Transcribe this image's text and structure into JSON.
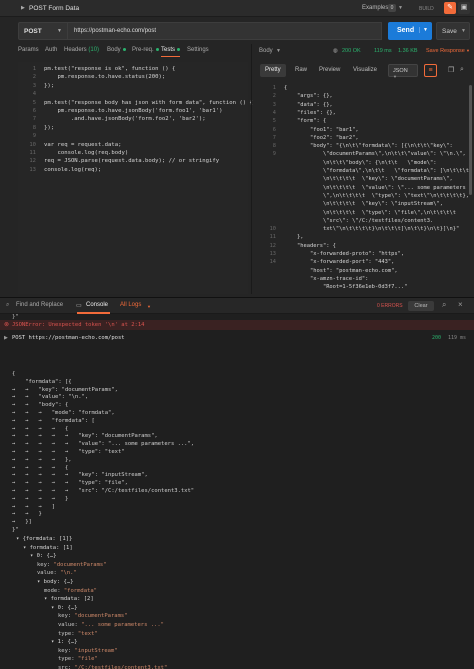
{
  "window": {
    "title": "POST Form Data",
    "examples_label": "Examples",
    "examples_count": "0",
    "build_label": "BUILD"
  },
  "request": {
    "method": "POST",
    "url": "https://postman-echo.com/post",
    "send_label": "Send",
    "save_label": "Save"
  },
  "request_tabs": [
    {
      "label": "Params"
    },
    {
      "label": "Auth"
    },
    {
      "label": "Headers",
      "count": "(10)"
    },
    {
      "label": "Body"
    },
    {
      "label": "Pre-req."
    },
    {
      "label": "Tests"
    },
    {
      "label": "Settings"
    }
  ],
  "test_script": [
    "pm.test(\"response is ok\", function () {",
    "    pm.response.to.have.status(200);",
    "});",
    "",
    "pm.test(\"response body has json with form data\", function () {",
    "    pm.response.to.have.jsonBody('form.foo1', 'bar1')",
    "        .and.have.jsonBody('form.foo2', 'bar2');",
    "});",
    "",
    "var req = request.data;",
    "    console.log(req.body)",
    "req = JSON.parse(request.data.body); // or stringify",
    "console.log(req);"
  ],
  "test_line_numbers": [
    "1",
    "2",
    "3",
    "4",
    "5",
    "6",
    "7",
    "8",
    "9",
    "10",
    "11",
    "12",
    "13"
  ],
  "response": {
    "body_label": "Body",
    "status": "200 OK",
    "time": "119 ms",
    "size": "1.36 KB",
    "save_label": "Save Response",
    "view_tabs": [
      "Pretty",
      "Raw",
      "Preview",
      "Visualize"
    ],
    "format": "JSON",
    "line_numbers": [
      "1",
      "2",
      "3",
      "4",
      "5",
      "6",
      "7",
      "8",
      "9",
      "",
      "",
      "",
      "",
      "",
      "",
      "",
      "",
      "10",
      "11",
      "12",
      "13",
      "14",
      ""
    ],
    "lines": [
      "{",
      "    \"args\": {},",
      "    \"data\": {},",
      "    \"files\": {},",
      "    \"form\": {",
      "        \"foo1\": \"bar1\",",
      "        \"foo2\": \"bar2\",",
      "        \"body\": \"{\\n\\t\\\"formdata\\\": [{\\n\\t\\t\\\"key\\\":",
      "            \\\"documentParams\\\",\\n\\t\\t\\\"value\\\": \\\"\\n.\\\",",
      "            \\n\\t\\t\\\"body\\\": {\\n\\t\\t   \\\"mode\\\":",
      "            \\\"formdata\\\",\\n\\t\\t   \\\"formdata\\\": [\\n\\t\\t\\t\\t",
      "            \\n\\t\\t\\t\\t  \\\"key\\\": \\\"documentParams\\\",",
      "            \\n\\t\\t\\t\\t  \\\"value\\\": \\\"... some parameters ...",
      "            \\\",\\n\\t\\t\\t\\t  \\\"type\\\": \\\"text\\\"\\n\\t\\t\\t\\t},",
      "            \\n\\t\\t\\t\\t  \\\"key\\\": \\\"inputStream\\\",",
      "            \\n\\t\\t\\t\\t  \\\"type\\\": \\\"file\\\",\\n\\t\\t\\t\\t",
      "            \\\"src\\\": \\\"/C:/testfiles/content3.",
      "            txt\\\"\\n\\t\\t\\t\\t}\\n\\t\\t\\t]\\n\\t\\t}\\n\\t}]\\n}\"",
      "    },",
      "    \"headers\": {",
      "        \"x-forwarded-proto\": \"https\",",
      "        \"x-forwarded-port\": \"443\",",
      "        \"host\": \"postman-echo.com\",",
      "        \"x-amzn-trace-id\": ",
      "            \"Root=1-5f36e1eb-0d3f7...\""
    ]
  },
  "console": {
    "find_replace_label": "Find and Replace",
    "console_label": "Console",
    "all_logs_label": "All Logs",
    "errors_label": "0 ERRORS",
    "clear_label": "Clear",
    "error_line": "JSONError: Unexpected token '\\n' at 2:14",
    "request_line": "POST https://postman-echo.com/post",
    "request_status": "200",
    "request_time": "119 ms",
    "raw_lines": [
      "{",
      "    \"formdata\": [{",
      "→   →   \"key\": \"documentParams\",",
      "→   →   \"value\": \"\\n.\",",
      "→   →   \"body\": {",
      "→   →   →   \"mode\": \"formdata\",",
      "→   →   →   \"formdata\": [",
      "→   →   →   →   {",
      "→   →   →   →   →   \"key\": \"documentParams\",",
      "→   →   →   →   →   \"value\": \"... some parameters ...\",",
      "→   →   →   →   →   \"type\": \"text\"",
      "→   →   →   →   },",
      "→   →   →   →   {",
      "→   →   →   →   →   \"key\": \"inputStream\",",
      "→   →   →   →   →   \"type\": \"file\",",
      "→   →   →   →   →   \"src\": \"/C:/testfiles/content3.txt\"",
      "→   →   →   →   }",
      "→   →   →   ]",
      "→   →   }",
      "→   }]",
      "}\""
    ],
    "tree": [
      {
        "indent": 0,
        "text": "▾ {formdata: [1]}",
        "kind": "head"
      },
      {
        "indent": 1,
        "text": "▾ formdata: [1]",
        "kind": "head"
      },
      {
        "indent": 2,
        "text": "▾ 0: {…}",
        "kind": "head"
      },
      {
        "indent": 3,
        "key": "key: ",
        "val": "\"documentParams\""
      },
      {
        "indent": 3,
        "key": "value: ",
        "val": "\"\\n.\""
      },
      {
        "indent": 3,
        "text": "▾ body: {…}",
        "kind": "head"
      },
      {
        "indent": 4,
        "key": "mode: ",
        "val": "\"formdata\""
      },
      {
        "indent": 4,
        "text": "▾ formdata: [2]",
        "kind": "head"
      },
      {
        "indent": 5,
        "text": "▾ 0: {…}",
        "kind": "head"
      },
      {
        "indent": 6,
        "key": "key: ",
        "val": "\"documentParams\""
      },
      {
        "indent": 6,
        "key": "value: ",
        "val": "\"... some parameters ...\""
      },
      {
        "indent": 6,
        "key": "type: ",
        "val": "\"text\""
      },
      {
        "indent": 5,
        "text": "▾ 1: {…}",
        "kind": "head"
      },
      {
        "indent": 6,
        "key": "key: ",
        "val": "\"inputStream\""
      },
      {
        "indent": 6,
        "key": "type: ",
        "val": "\"file\""
      },
      {
        "indent": 6,
        "key": "src: ",
        "val": "\"/C:/testfiles/content3.txt\""
      }
    ]
  },
  "colors": {
    "accent": "#f26b3a",
    "send": "#1b7bd9",
    "ok": "#2bb36e",
    "error": "#d9534f"
  }
}
